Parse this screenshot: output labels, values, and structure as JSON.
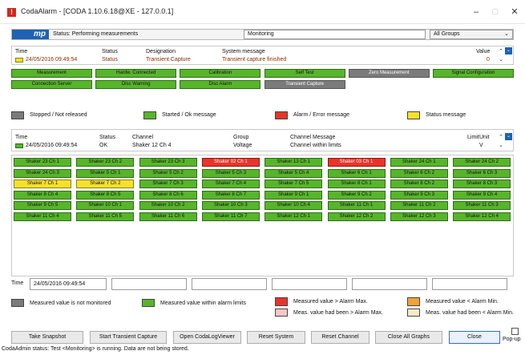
{
  "window": {
    "title": "CodaAlarm - [CODA 1.10.6.18@XE - 127.0.0.1]",
    "icon_glyph": "!",
    "minimize": "–",
    "maximize": "□",
    "close": "✕"
  },
  "status": {
    "logo": "mp",
    "text": "Status: Performing measurements",
    "mode": "Monitoring",
    "group_select": "All Groups"
  },
  "system_messages": {
    "headers": [
      "Time",
      "Status",
      "Designation",
      "System message",
      "Value"
    ],
    "row": [
      "24/05/2016 09:49:54",
      "Status",
      "Transient Capture",
      "Transient capture finished",
      "0"
    ]
  },
  "function_buttons": {
    "row1": [
      "Measurement",
      "Hardw. Connected",
      "Calibration",
      "Self Test",
      "Zero Measurement",
      "Signal Configuration"
    ],
    "row2": [
      "Connection Server",
      "Disc Warning",
      "Disc Alarm",
      "Transient Capture"
    ],
    "row1_state": [
      "green",
      "green",
      "green",
      "green",
      "grey",
      "green"
    ],
    "row2_state": [
      "green",
      "green",
      "green",
      "grey"
    ]
  },
  "legend_top": [
    {
      "label": "Stopped / Not released",
      "color": "#7b7b7b"
    },
    {
      "label": "Started / Ok message",
      "color": "#57b52a"
    },
    {
      "label": "Alarm / Error message",
      "color": "#e8342a"
    },
    {
      "label": "Status message",
      "color": "#f5e12b"
    }
  ],
  "channel_messages": {
    "headers": [
      "Time",
      "Status",
      "Channel",
      "Group",
      "Channel Message",
      "Limit",
      "Unit"
    ],
    "row": [
      "24/05/2016 09:49:54",
      "OK",
      "Shaker 12 Ch 4",
      "Voltage",
      "Channel within limits",
      "",
      "V"
    ]
  },
  "channels": [
    [
      "Shaker 23 Ch 1",
      "green"
    ],
    [
      "Shaker 23 Ch 2",
      "green"
    ],
    [
      "Shaker 23 Ch 3",
      "green"
    ],
    [
      "Shaker 02 Ch 1",
      "red"
    ],
    [
      "Shaker 13 Ch 1",
      "green"
    ],
    [
      "Shaker 03 Ch 1",
      "red"
    ],
    [
      "Shaker 24 Ch 1",
      "green"
    ],
    [
      "Shaker 24 Ch 2",
      "green"
    ],
    [
      "Shaker 24 Ch 3",
      "green"
    ],
    [
      "Shaker 5 Ch 1",
      "green"
    ],
    [
      "Shaker 5 Ch 2",
      "green"
    ],
    [
      "Shaker 5 Ch 3",
      "green"
    ],
    [
      "Shaker 5 Ch 4",
      "green"
    ],
    [
      "Shaker 6 Ch 1",
      "green"
    ],
    [
      "Shaker 6 Ch 2",
      "green"
    ],
    [
      "Shaker 6 Ch 3",
      "green"
    ],
    [
      "Shaker 7 Ch 1",
      "yellow"
    ],
    [
      "Shaker 7 Ch 2",
      "yellow"
    ],
    [
      "Shaker 7 Ch 3",
      "green"
    ],
    [
      "Shaker 7 Ch 4",
      "green"
    ],
    [
      "Shaker 7 Ch 5",
      "green"
    ],
    [
      "Shaker 8 Ch 1",
      "green"
    ],
    [
      "Shaker 8 Ch 2",
      "green"
    ],
    [
      "Shaker 8 Ch 3",
      "green"
    ],
    [
      "Shaker 8 Ch 4",
      "green"
    ],
    [
      "Shaker 8 Ch 5",
      "green"
    ],
    [
      "Shaker 8 Ch 6",
      "green"
    ],
    [
      "Shaker 8 Ch 7",
      "green"
    ],
    [
      "Shaker 9 Ch 1",
      "green"
    ],
    [
      "Shaker 9 Ch 2",
      "green"
    ],
    [
      "Shaker 9 Ch 3",
      "green"
    ],
    [
      "Shaker 9 Ch 4",
      "green"
    ],
    [
      "Shaker 9 Ch 5",
      "green"
    ],
    [
      "Shaker 10 Ch 1",
      "green"
    ],
    [
      "Shaker 10 Ch 2",
      "green"
    ],
    [
      "Shaker 10 Ch 3",
      "green"
    ],
    [
      "Shaker 10 Ch 4",
      "green"
    ],
    [
      "Shaker 11 Ch 1",
      "green"
    ],
    [
      "Shaker 11 Ch 2",
      "green"
    ],
    [
      "Shaker 11 Ch 3",
      "green"
    ],
    [
      "Shaker 11 Ch 4",
      "green"
    ],
    [
      "Shaker 11 Ch 5",
      "green"
    ],
    [
      "Shaker 11 Ch 6",
      "green"
    ],
    [
      "Shaker 11 Ch 7",
      "green"
    ],
    [
      "Shaker 12 Ch 1",
      "green"
    ],
    [
      "Shaker 12 Ch 2",
      "green"
    ],
    [
      "Shaker 12 Ch 3",
      "green"
    ],
    [
      "Shaker 12 Ch 4",
      "green"
    ]
  ],
  "time_row": {
    "label": "Time",
    "value": "24/05/2016 09:49:54"
  },
  "legend_bottom": [
    {
      "label": "Measured value is not monitored",
      "color": "#7b7b7b"
    },
    {
      "label": "Measured value within alarm limits",
      "color": "#57b52a"
    },
    {
      "label": "Measured value > Alarm Max.",
      "color": "#e8342a"
    },
    {
      "label": "Meas. value had been > Alarm Max.",
      "color": "#f7c7c5"
    },
    {
      "label": "Measured value < Alarm Min.",
      "color": "#f4a236"
    },
    {
      "label": "Meas. value had been < Alarm Min.",
      "color": "#fbe9c6"
    }
  ],
  "bottom_buttons": [
    "Take Snapshot",
    "Start Transient Capture",
    "Open CodaLogViewer",
    "Reset System",
    "Reset Channel",
    "Close All Graphs",
    "Close"
  ],
  "popup_label": "Pop-up",
  "footer": "CodaAdmin status: Test <Monitoring> is running. Data are not being stored."
}
